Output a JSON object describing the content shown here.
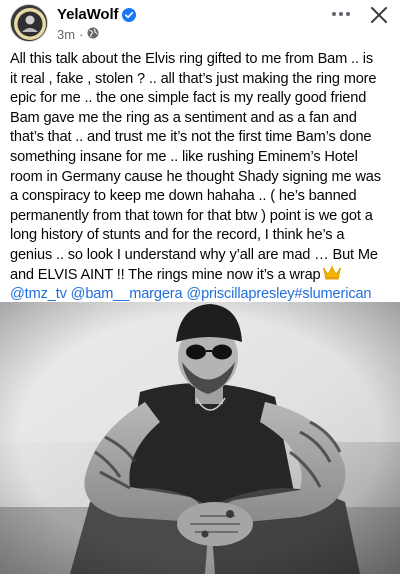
{
  "post": {
    "author": "YelaWolf",
    "verified": true,
    "time": "3m",
    "separator": "·",
    "privacy_icon": "globe-icon",
    "more_icon": "more-horizontal-icon",
    "close_icon": "close-icon",
    "text_lines": [
      "All this talk about the Elvis ring gifted to me from Bam .. is",
      "it real , fake , stolen ? .. all that’s just making the ring more",
      "epic for me .. the one simple fact is my really good friend",
      "Bam gave me the ring as a sentiment and as a fan and",
      "that’s that .. and trust me it’s not the first time Bam’s done",
      "something insane for me .. like rushing Eminem’s Hotel",
      "room in Germany cause he thought Shady signing me was",
      "a conspiracy to keep me down hahaha .. ( he’s banned",
      "permanently from that town for that btw ) point is we got a",
      "long history of stunts and for the record, I think he’s a",
      "genius .. so look I understand why y’all are mad … But Me",
      "and ELVIS AINT !! The rings mine now it’s a wrap"
    ],
    "emoji": "crown-emoji",
    "tags": [
      "@tmz_tv",
      "@bam__margera",
      "@priscillapresley",
      "#slumerican"
    ]
  },
  "colors": {
    "link": "#216fdb",
    "verified": "#1877f2",
    "meta": "#65676b",
    "crown": "#f5b400"
  }
}
